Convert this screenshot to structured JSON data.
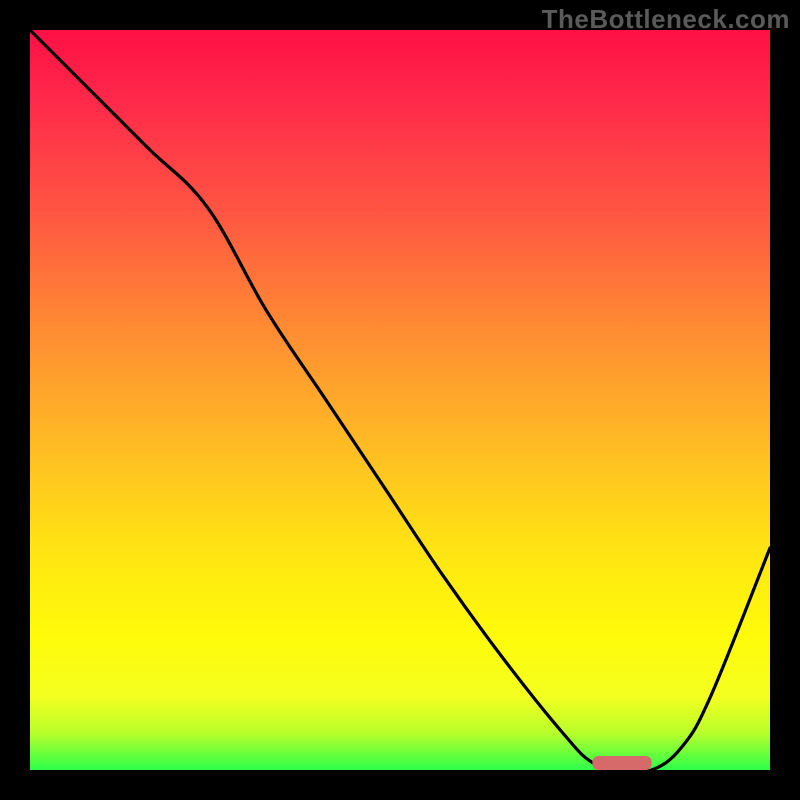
{
  "watermark": "TheBottleneck.com",
  "chart_data": {
    "type": "line",
    "title": "",
    "xlabel": "",
    "ylabel": "",
    "xlim": [
      0,
      100
    ],
    "ylim": [
      0,
      100
    ],
    "x": [
      0,
      8,
      16,
      24,
      32,
      40,
      48,
      56,
      64,
      72,
      76,
      80,
      84,
      88,
      92,
      100
    ],
    "values": [
      100,
      92,
      84,
      76,
      62,
      50,
      38,
      26,
      15,
      5,
      1,
      0,
      0,
      3,
      10,
      30
    ],
    "optimum_marker": {
      "x_start": 76,
      "x_end": 84,
      "y": 0
    },
    "colors": {
      "top": "#ff1045",
      "mid": "#ffe413",
      "bottom": "#2bff4a",
      "line": "#000000",
      "marker": "#d66a6a"
    }
  }
}
